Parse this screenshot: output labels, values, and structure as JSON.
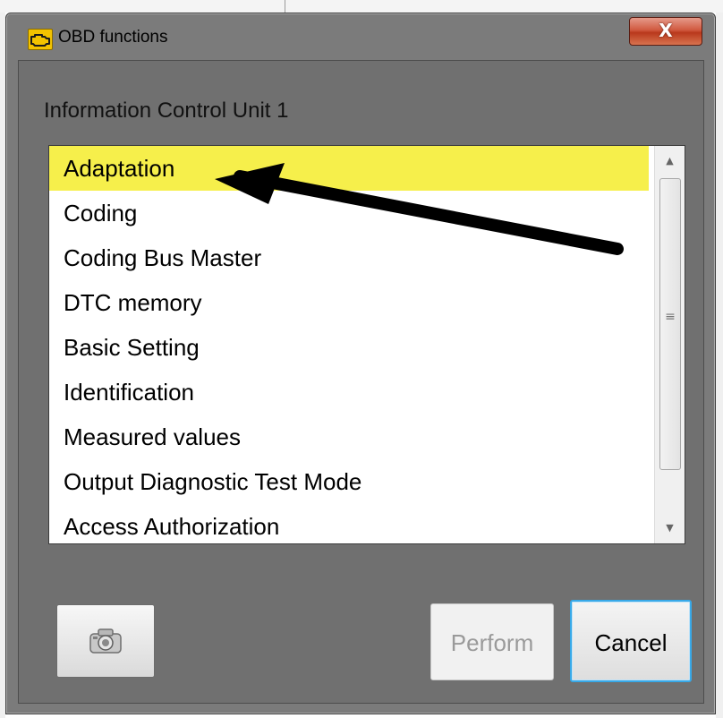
{
  "window": {
    "title": "OBD functions",
    "icon": "engine-warning-icon",
    "close_glyph": "X"
  },
  "section": {
    "label": "Information Control Unit 1"
  },
  "function_list": {
    "selected_index": 0,
    "highlight_color": "#f6ef4b",
    "items": [
      {
        "label": "Adaptation"
      },
      {
        "label": "Coding"
      },
      {
        "label": "Coding Bus Master"
      },
      {
        "label": "DTC memory"
      },
      {
        "label": "Basic Setting"
      },
      {
        "label": "Identification"
      },
      {
        "label": "Measured values"
      },
      {
        "label": "Output Diagnostic Test Mode"
      },
      {
        "label": "Access Authorization"
      }
    ],
    "scrollbar": {
      "up_icon": "scroll-up-arrow-icon",
      "down_icon": "scroll-down-arrow-icon"
    }
  },
  "buttons": {
    "screenshot_icon": "camera-icon",
    "perform_label": "Perform",
    "perform_enabled": false,
    "cancel_label": "Cancel"
  },
  "annotation": {
    "icon": "pointer-arrow-icon",
    "color": "#000000"
  },
  "colors": {
    "dialog_background": "#7b7b7b",
    "close_button": "#c9472a",
    "focus_border": "#38a9e8"
  }
}
